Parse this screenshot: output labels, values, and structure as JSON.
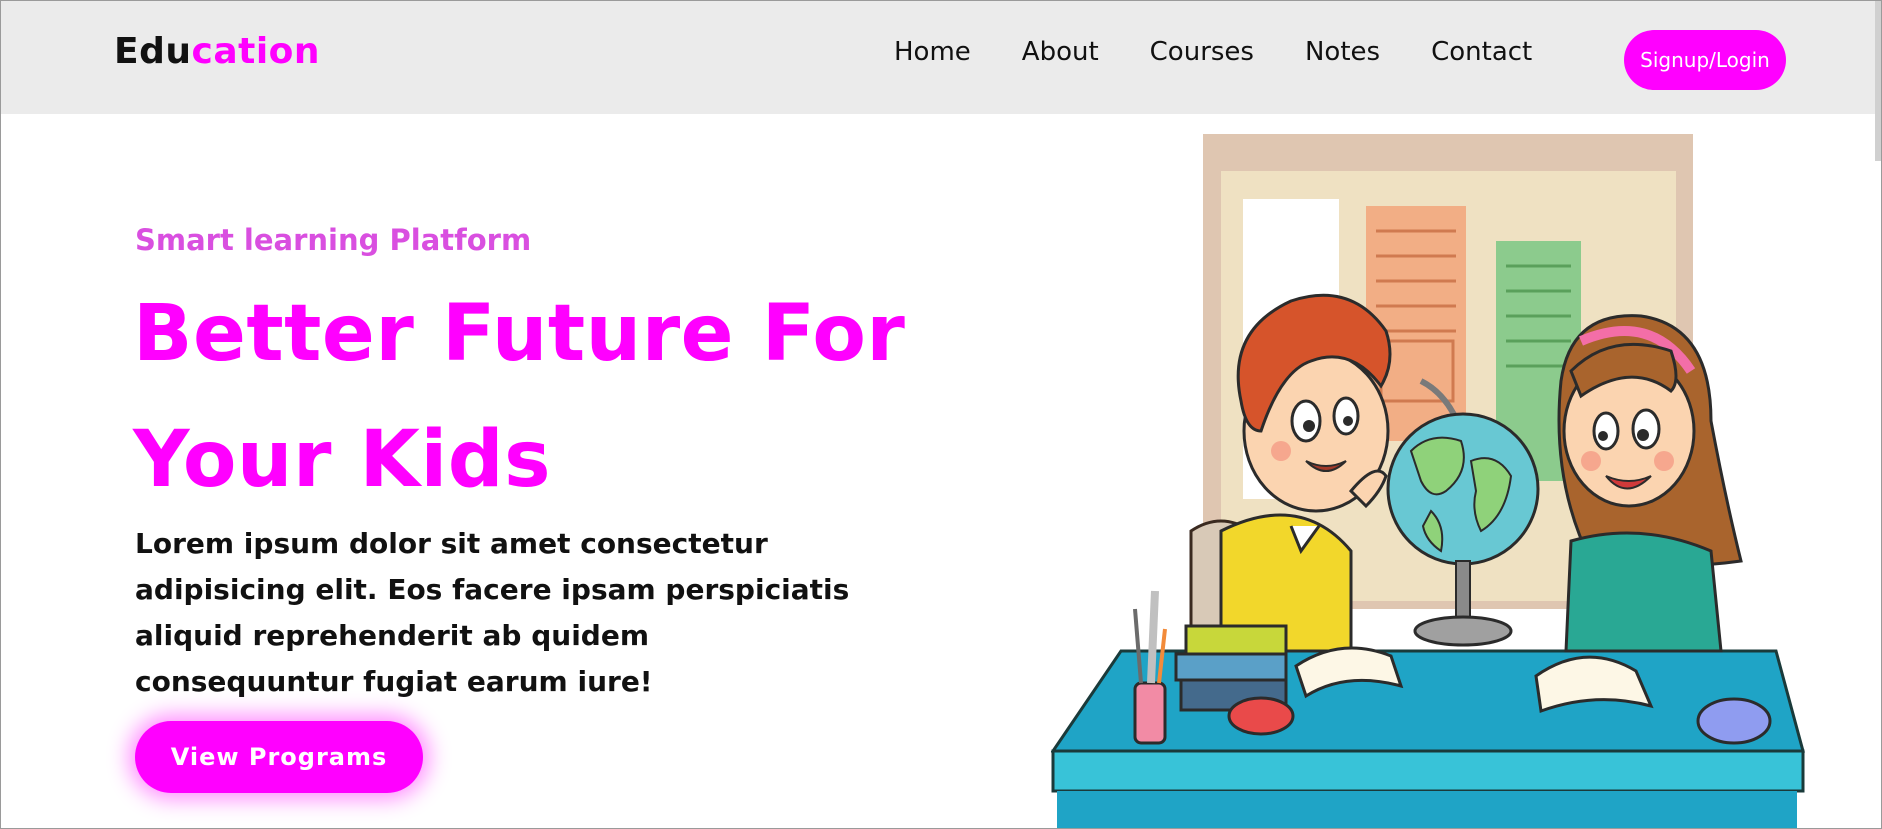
{
  "navbar": {
    "logo_main": "Edu",
    "logo_accent": "cation",
    "links": [
      "Home",
      "About",
      "Courses",
      "Notes",
      "Contact"
    ],
    "signup_label": "Signup/Login"
  },
  "hero": {
    "subtitle": "Smart learning Platform",
    "title_line1": "Better Future For",
    "title_line2": "Your Kids",
    "description": "Lorem ipsum dolor sit amet consectetur adipisicing elit. Eos facere ipsam perspiciatis aliquid reprehenderit ab quidem consequuntur fugiat earum iure!",
    "cta_label": "View Programs"
  },
  "colors": {
    "accent": "#ff00ff",
    "subtitle": "#d94fe0",
    "navbar_bg": "#ebebeb"
  },
  "illustration": {
    "icon": "kids-studying-globe-illustration"
  }
}
